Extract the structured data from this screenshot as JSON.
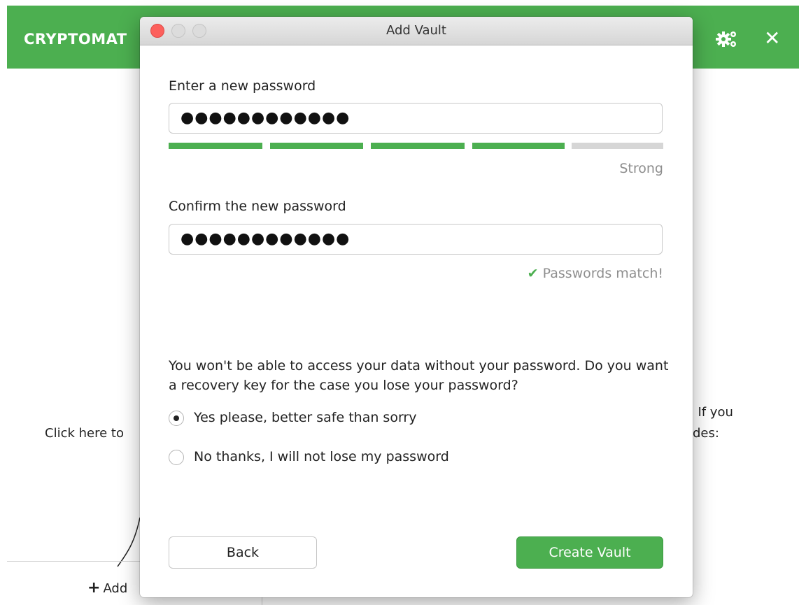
{
  "app": {
    "title": "CRYPTOMAT",
    "click_hint": "Click here to",
    "right_text_1": ". If you",
    "right_text_2": "des:",
    "add_button": "Add"
  },
  "dialog": {
    "title": "Add Vault",
    "new_password_label": "Enter a new password",
    "new_password_value": "●●●●●●●●●●●●",
    "strength_segments_filled": 4,
    "strength_segments_total": 5,
    "strength_text": "Strong",
    "confirm_label": "Confirm the new password",
    "confirm_value": "●●●●●●●●●●●●",
    "match_text": "Passwords match!",
    "warning": "You won't be able to access your data without your password. Do you want a recovery key for the case you lose your password?",
    "option_yes": "Yes please, better safe than sorry",
    "option_no": "No thanks, I will not lose my password",
    "selected_option": "yes",
    "back_button": "Back",
    "create_button": "Create Vault"
  },
  "colors": {
    "accent": "#4caf50",
    "strength_empty": "#d6d6d6",
    "muted_text": "#8e8e8e"
  },
  "icons": [
    "gear-icon",
    "close-icon",
    "plus-icon",
    "check-icon"
  ]
}
